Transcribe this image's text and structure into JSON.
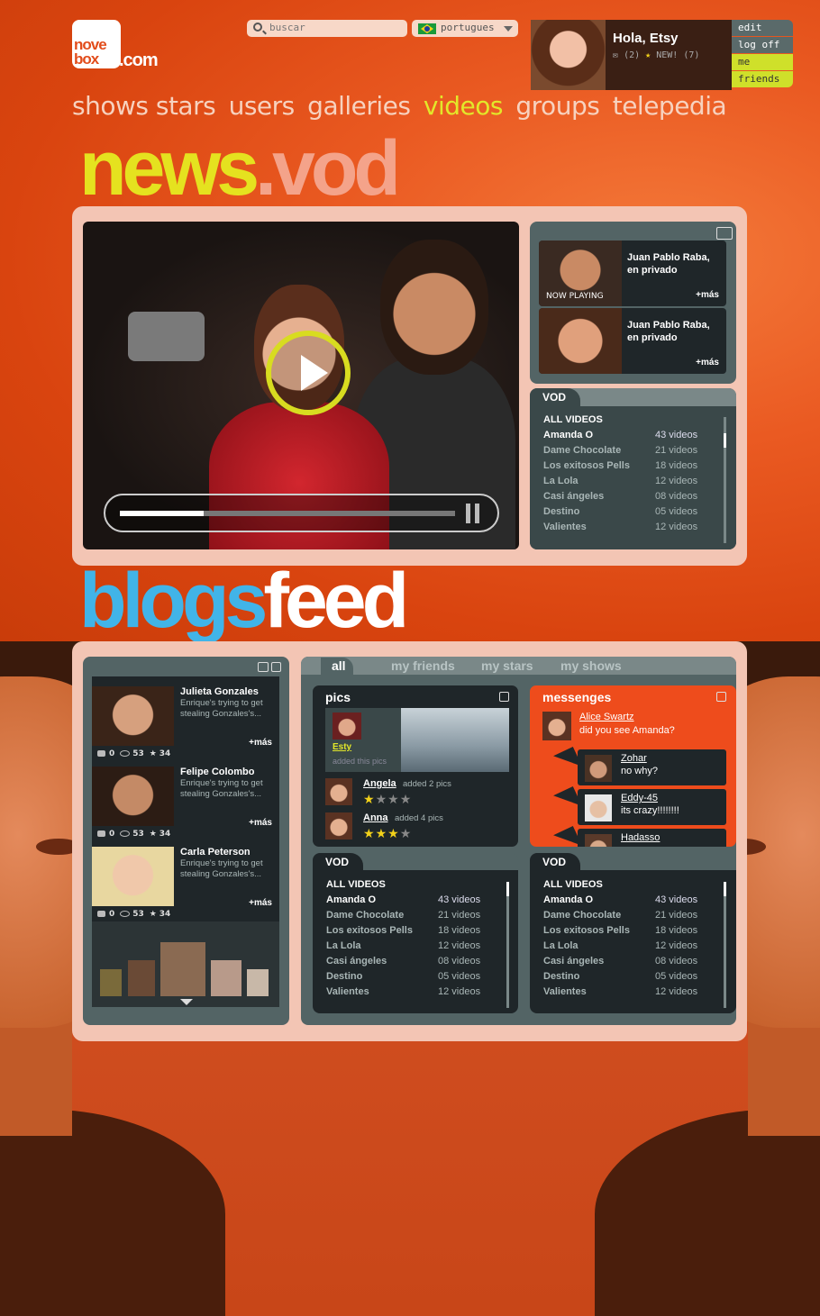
{
  "brand": {
    "logo_line1": "nove",
    "logo_line2": "box",
    "logo_domain": ".com"
  },
  "search": {
    "placeholder": "buscar"
  },
  "language": {
    "selected": "portugues"
  },
  "user": {
    "greeting": "Hola, Etsy",
    "messages": "(2)",
    "new_label": "NEW! (7)"
  },
  "user_menu": [
    "edit",
    "log off",
    "me",
    "friends"
  ],
  "nav": [
    "shows stars",
    "users",
    "galleries",
    "videos",
    "groups",
    "telepedia"
  ],
  "nav_active": "videos",
  "headings": {
    "news_a": "news",
    "news_b": ".vod",
    "blogs_a": "blogs",
    "blogs_b": "feed"
  },
  "player": {
    "progress": 0.25
  },
  "playlist": [
    {
      "title": "Juan Pablo Raba, en privado",
      "more": "+más",
      "status": "NOW PLAYING"
    },
    {
      "title": "Juan Pablo Raba, en privado",
      "more": "+más",
      "status": ""
    }
  ],
  "vod": {
    "tab": "VOD",
    "all": "ALL VIDEOS",
    "rows": [
      {
        "name": "Amanda O",
        "count": "43 videos"
      },
      {
        "name": "Dame Chocolate",
        "count": "21 videos"
      },
      {
        "name": "Los exitosos Pells",
        "count": "18 videos"
      },
      {
        "name": "La Lola",
        "count": "12 videos"
      },
      {
        "name": "Casi ángeles",
        "count": "08 videos"
      },
      {
        "name": "Destino",
        "count": "05 videos"
      },
      {
        "name": "Valientes",
        "count": "12 videos"
      }
    ]
  },
  "blogs": [
    {
      "name": "Julieta Gonzales",
      "desc": "Enrique's trying to get stealing Gonzales's...",
      "more": "+más",
      "comments": "0",
      "views": "53",
      "stars": "34"
    },
    {
      "name": "Felipe Colombo",
      "desc": "Enrique's trying to get stealing Gonzales's...",
      "more": "+más",
      "comments": "0",
      "views": "53",
      "stars": "34"
    },
    {
      "name": "Carla Peterson",
      "desc": "Enrique's trying to get stealing Gonzales's...",
      "more": "+más",
      "comments": "0",
      "views": "53",
      "stars": "34"
    }
  ],
  "feed_tabs": [
    "all",
    "my friends",
    "my stars",
    "my shows"
  ],
  "pics": {
    "title": "pics",
    "featured_user": "Esty",
    "featured_action": "added this pics",
    "items": [
      {
        "user": "Angela",
        "action": "added 2 pics",
        "rating": 1
      },
      {
        "user": "Anna",
        "action": "added 4 pics",
        "rating": 3
      }
    ]
  },
  "messages": {
    "title": "messenges",
    "items": [
      {
        "user": "Alice Swartz",
        "text": "did you see Amanda?"
      },
      {
        "user": "Zohar",
        "text": "no why?"
      },
      {
        "user": "Eddy-45",
        "text": "its crazy!!!!!!!!"
      },
      {
        "user": "Hadasso",
        "text": ""
      }
    ]
  },
  "colors": {
    "accent_yellow": "#e5e21f",
    "accent_blue": "#41b4e8",
    "orange": "#e24d1c",
    "panel_dark": "#536465"
  }
}
